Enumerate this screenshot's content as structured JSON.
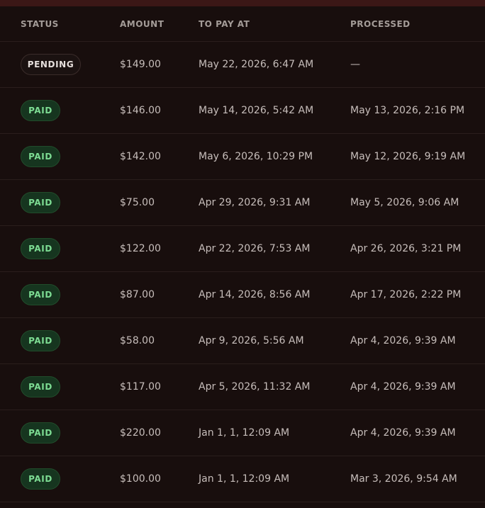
{
  "table": {
    "headers": {
      "status": "STATUS",
      "amount": "AMOUNT",
      "to_pay_at": "TO PAY AT",
      "processed": "PROCESSED"
    },
    "rows": [
      {
        "status": "PENDING",
        "status_kind": "pending",
        "amount": "$149.00",
        "to_pay_at": "May 22, 2026, 6:47 AM",
        "processed": "—"
      },
      {
        "status": "PAID",
        "status_kind": "paid",
        "amount": "$146.00",
        "to_pay_at": "May 14, 2026, 5:42 AM",
        "processed": "May 13, 2026, 2:16 PM"
      },
      {
        "status": "PAID",
        "status_kind": "paid",
        "amount": "$142.00",
        "to_pay_at": "May 6, 2026, 10:29 PM",
        "processed": "May 12, 2026, 9:19 AM"
      },
      {
        "status": "PAID",
        "status_kind": "paid",
        "amount": "$75.00",
        "to_pay_at": "Apr 29, 2026, 9:31 AM",
        "processed": "May 5, 2026, 9:06 AM"
      },
      {
        "status": "PAID",
        "status_kind": "paid",
        "amount": "$122.00",
        "to_pay_at": "Apr 22, 2026, 7:53 AM",
        "processed": "Apr 26, 2026, 3:21 PM"
      },
      {
        "status": "PAID",
        "status_kind": "paid",
        "amount": "$87.00",
        "to_pay_at": "Apr 14, 2026, 8:56 AM",
        "processed": "Apr 17, 2026, 2:22 PM"
      },
      {
        "status": "PAID",
        "status_kind": "paid",
        "amount": "$58.00",
        "to_pay_at": "Apr 9, 2026, 5:56 AM",
        "processed": "Apr 4, 2026, 9:39 AM"
      },
      {
        "status": "PAID",
        "status_kind": "paid",
        "amount": "$117.00",
        "to_pay_at": "Apr 5, 2026, 11:32 AM",
        "processed": "Apr 4, 2026, 9:39 AM"
      },
      {
        "status": "PAID",
        "status_kind": "paid",
        "amount": "$220.00",
        "to_pay_at": "Jan 1, 1, 12:09 AM",
        "processed": "Apr 4, 2026, 9:39 AM"
      },
      {
        "status": "PAID",
        "status_kind": "paid",
        "amount": "$100.00",
        "to_pay_at": "Jan 1, 1, 12:09 AM",
        "processed": "Mar 3, 2026, 9:54 AM"
      }
    ]
  },
  "colors": {
    "background": "#150c0b",
    "top_strip": "#3b1716",
    "paid_badge_text": "#7ddc93",
    "paid_badge_bg": "#16351f",
    "pending_badge_text": "#e6dfdc"
  }
}
